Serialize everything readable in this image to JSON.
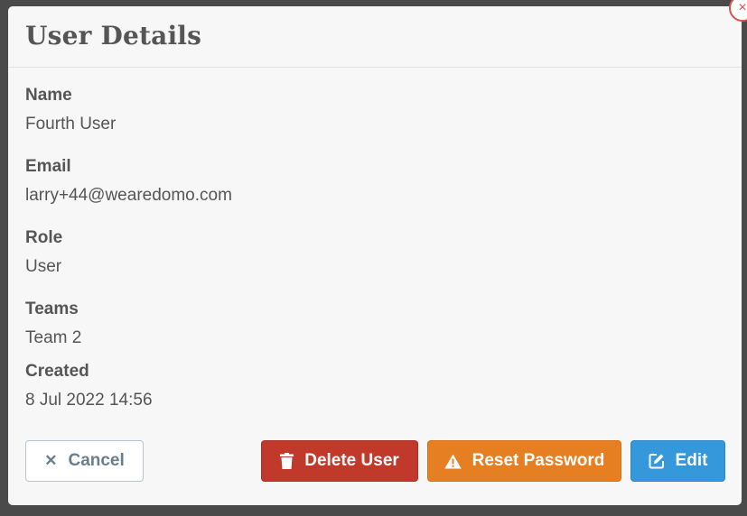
{
  "modal": {
    "title": "User Details",
    "close_glyph": "×"
  },
  "fields": {
    "name": {
      "label": "Name",
      "value": "Fourth User"
    },
    "email": {
      "label": "Email",
      "value": "larry+44@wearedomo.com"
    },
    "role": {
      "label": "Role",
      "value": "User"
    },
    "teams": {
      "label": "Teams",
      "value": "Team 2"
    },
    "created": {
      "label": "Created",
      "value": "8 Jul 2022 14:56"
    }
  },
  "buttons": {
    "cancel": {
      "label": "Cancel",
      "icon": "close-icon",
      "glyph": "✕"
    },
    "delete": {
      "label": "Delete User",
      "icon": "trash-icon"
    },
    "reset": {
      "label": "Reset Password",
      "icon": "warning-icon"
    },
    "edit": {
      "label": "Edit",
      "icon": "edit-icon"
    }
  },
  "colors": {
    "delete": "#c0392b",
    "reset": "#e67e22",
    "edit": "#3498db",
    "close_ring": "#d9534f"
  }
}
